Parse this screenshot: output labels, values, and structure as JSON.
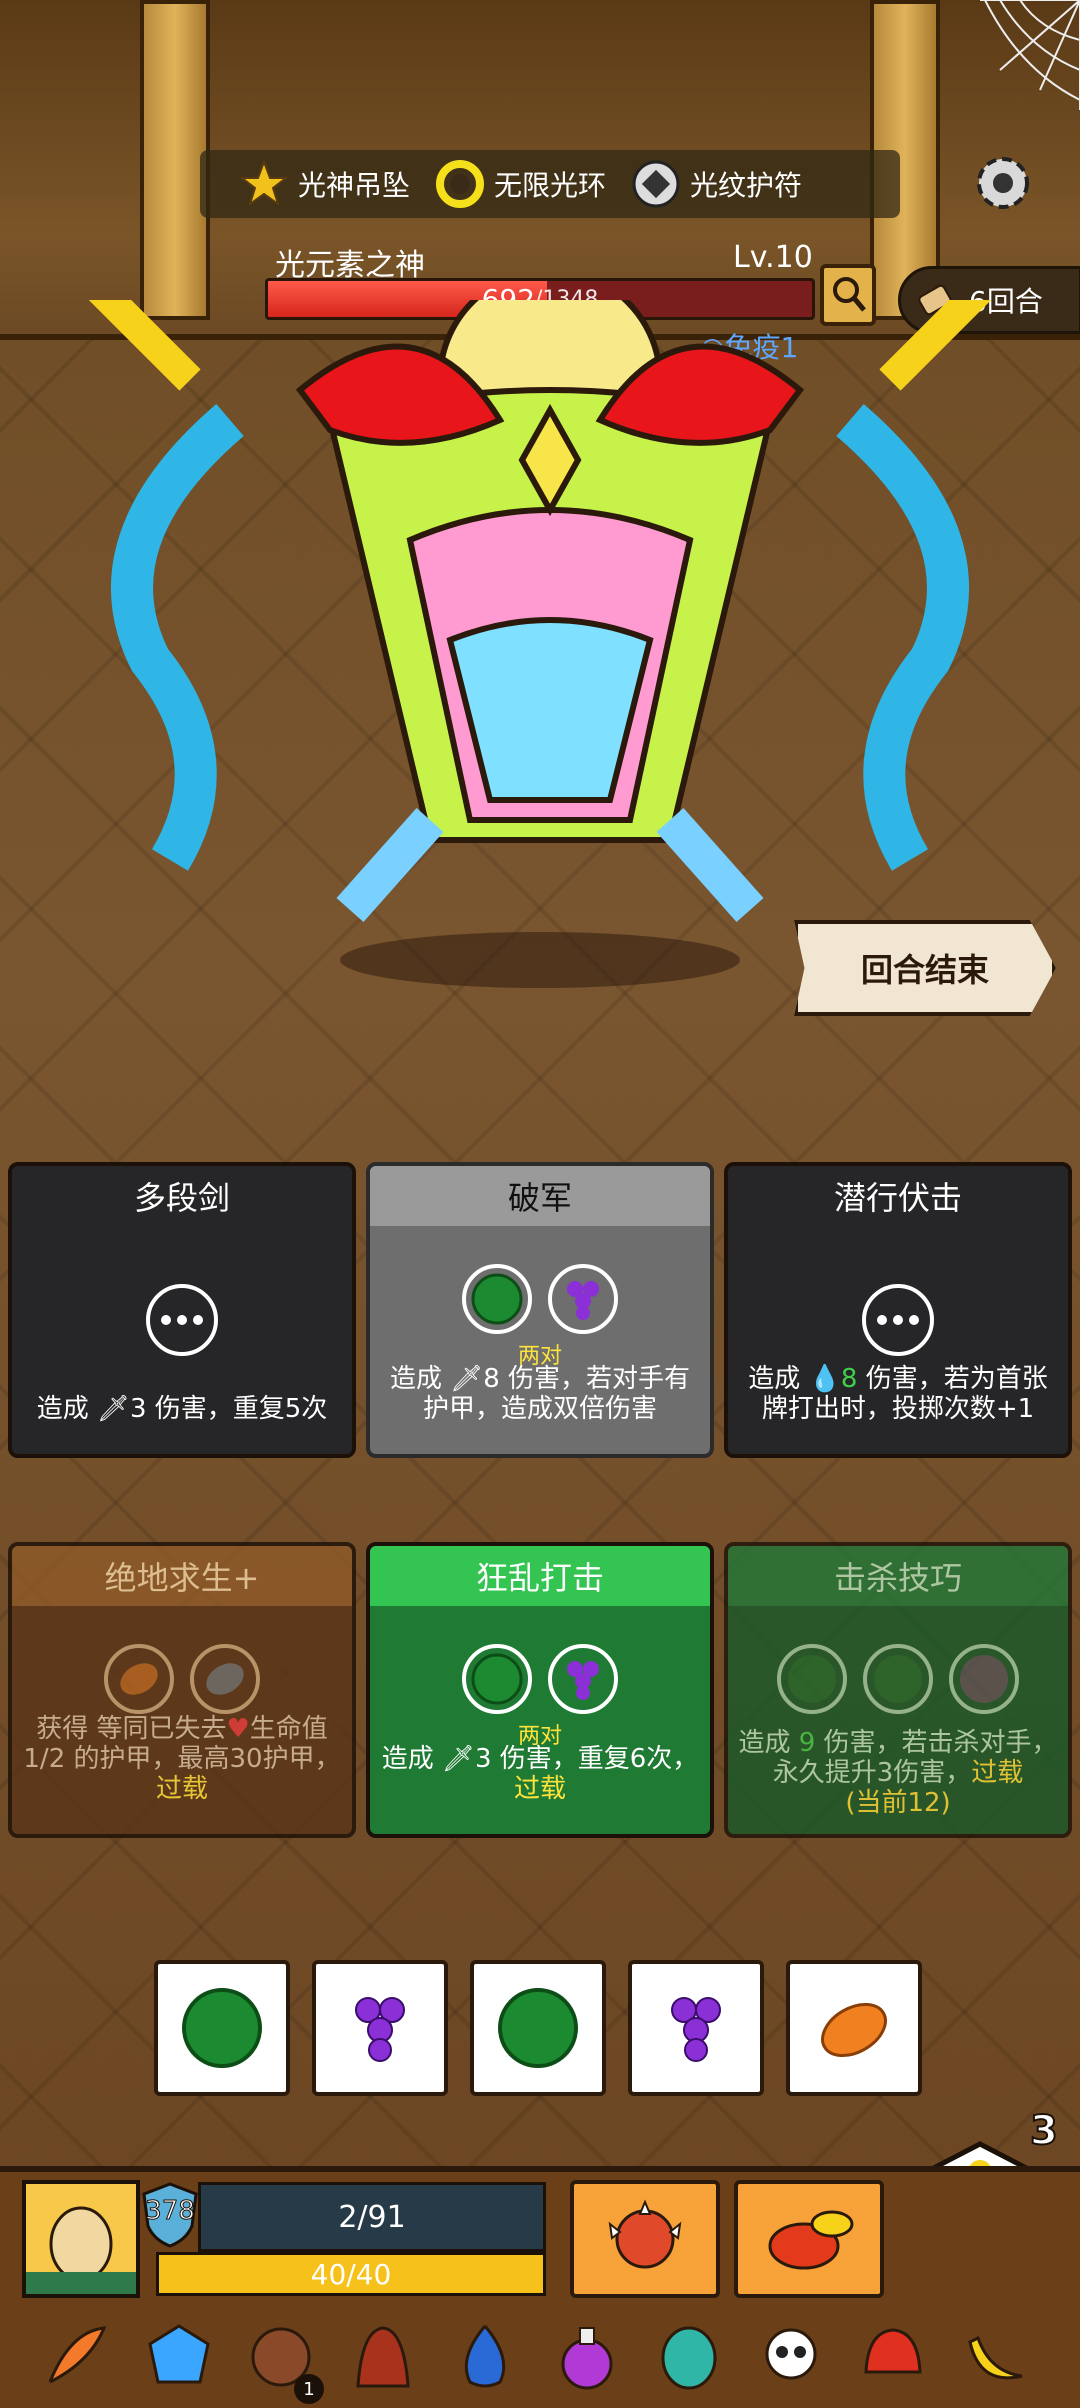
{
  "relics": [
    {
      "label": "光神吊坠",
      "icon": "star-pendant-icon"
    },
    {
      "label": "无限光环",
      "icon": "halo-ring-icon"
    },
    {
      "label": "光纹护符",
      "icon": "rune-amulet-icon"
    }
  ],
  "enemy": {
    "name": "光元素之神",
    "level": "Lv.10",
    "hp_current": "692",
    "hp_max": "/1348",
    "hp_fraction": 0.513,
    "status": "免疫1"
  },
  "round": {
    "label": "6回合"
  },
  "end_turn_label": "回合结束",
  "cards": [
    {
      "title": "多段剑",
      "desc": "造成 🗡3 伤害，重复5次"
    },
    {
      "title": "破军",
      "pair": "两对",
      "desc": "造成 🗡8 伤害，若对手有护甲，造成双倍伤害"
    },
    {
      "title": "潜行伏击",
      "desc_pre": "造成 ",
      "desc_num": "8",
      "desc_post": " 伤害，若为首张牌打出时，投掷次数+1"
    },
    {
      "title": "绝地求生+",
      "desc_a": "获得 等同已失去",
      "desc_b": "生命值1/2 的护甲，最高30护甲，",
      "overload": "过载"
    },
    {
      "title": "狂乱打击",
      "pair": "两对",
      "desc": "造成 🗡3 伤害，重复6次，",
      "overload": "过载"
    },
    {
      "title": "击杀技巧",
      "desc_pre": "造成 ",
      "desc_num": "9",
      "desc_post": " 伤害，若击杀对手，永久提升3伤害，",
      "overload": "过载",
      "note": "(当前12)"
    }
  ],
  "dice": [
    "watermelon",
    "grape",
    "watermelon",
    "grape",
    "mango"
  ],
  "rolls_left": "3",
  "player": {
    "shield": "378",
    "block_text": "2/91",
    "hp_text": "40/40",
    "hp_fraction": 1.0
  },
  "inventory_badge": "1",
  "colors": {
    "accent_yellow": "#ffe23a",
    "hp_red": "#d6261c",
    "hp_yellow": "#f6c11a"
  }
}
